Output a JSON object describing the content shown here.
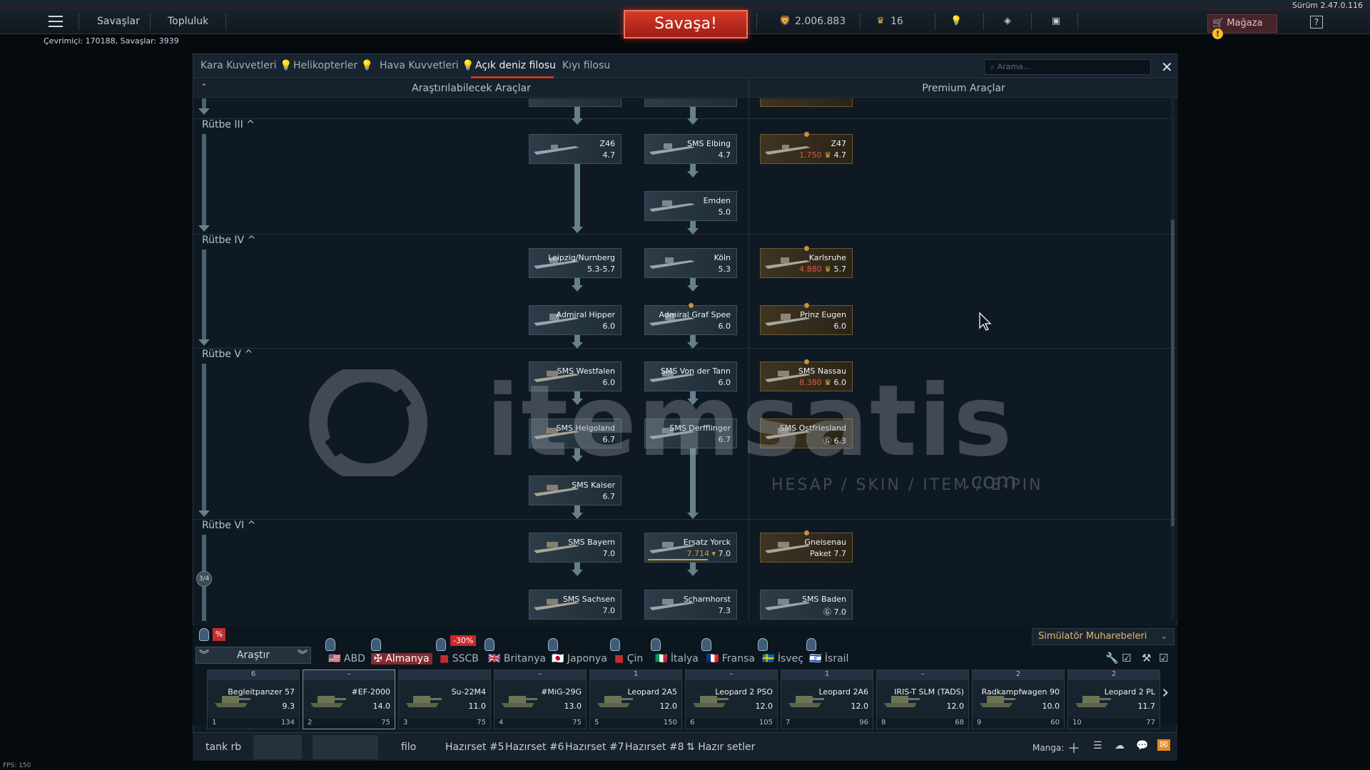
{
  "top": {
    "version": "Sürüm 2.47.0.116",
    "menu_items": [
      "Savaşlar",
      "Topluluk"
    ],
    "battle_button": "Savaşa!",
    "silver": "2.006.883",
    "gold": "16",
    "store": "Mağaza",
    "online": "Çevrimiçi: 170188, Savaşlar: 3939"
  },
  "tabs": {
    "items": [
      "Kara Kuvvetleri",
      "Helikopterler",
      "Hava Kuvvetleri",
      "Açık deniz filosu",
      "Kıyı filosu"
    ],
    "search_placeholder": "Arama..."
  },
  "headers": {
    "researchable": "Araştırılabilecek Araçlar",
    "premium": "Premium Araçlar"
  },
  "ranks": [
    "Rütbe III ^",
    "Rütbe IV ^",
    "Rütbe V ^",
    "Rütbe VI ^"
  ],
  "ships": {
    "z46": {
      "name": "Z46",
      "br": "4.7"
    },
    "elbing": {
      "name": "SMS Elbing",
      "br": "4.7"
    },
    "z47": {
      "name": "Z47",
      "price": "1.750",
      "br": "4.7"
    },
    "emden": {
      "name": "Emden",
      "br": "5.0"
    },
    "leipzig": {
      "name": "Leipzig/Nurnberg",
      "br": "5.3-5.7"
    },
    "koln": {
      "name": "Köln",
      "br": "5.3"
    },
    "karlsruhe": {
      "name": "Karlsruhe",
      "price": "4.880",
      "br": "5.7"
    },
    "hipper": {
      "name": "Admiral Hipper",
      "br": "6.0"
    },
    "spee": {
      "name": "Admiral Graf Spee",
      "br": "6.0"
    },
    "eugen": {
      "name": "Prinz Eugen",
      "br": "6.0"
    },
    "westfalen": {
      "name": "SMS Westfalen",
      "br": "6.0"
    },
    "tann": {
      "name": "SMS Von der Tann",
      "br": "6.0"
    },
    "nassau": {
      "name": "SMS Nassau",
      "price": "8.380",
      "br": "6.0"
    },
    "helgoland": {
      "name": "SMS Helgoland",
      "br": "6.7"
    },
    "derfflinger": {
      "name": "SMS Derfflinger",
      "br": "6.7"
    },
    "ostfriesland": {
      "name": "SMS Ostfriesland",
      "br": "6.3"
    },
    "kaiser": {
      "name": "SMS Kaiser",
      "br": "6.7"
    },
    "bayern": {
      "name": "SMS Bayern",
      "br": "7.0"
    },
    "yorck": {
      "name": "Ersatz Yorck",
      "price": "7.714",
      "br": "7.0"
    },
    "gneisenau": {
      "name": "Gneisenau",
      "sub": "Paket",
      "br": "7.7"
    },
    "sachsen": {
      "name": "SMS Sachsen",
      "br": "7.0"
    },
    "scharnhorst": {
      "name": "Scharnhorst",
      "br": "7.3"
    },
    "baden": {
      "name": "SMS Baden",
      "br": "7.0"
    }
  },
  "progress_badge": "3/4",
  "watermark": {
    "brand": "itemsatis",
    "tagline": "HESAP / SKIN / ITEM / E-PIN",
    "domain": ".com"
  },
  "research": "Araştır",
  "discount": "-30%",
  "mode": "Simülatör Muharebeleri",
  "nations": [
    "ABD",
    "Almanya",
    "SSCB",
    "Britanya",
    "Japonya",
    "Çin",
    "İtalya",
    "Fransa",
    "İsveç",
    "İsrail"
  ],
  "crew": [
    {
      "top": "6",
      "name": "Begleitpanzer 57",
      "br": "9.3",
      "num": "1",
      "cost": "134"
    },
    {
      "top": "–",
      "name": "#EF-2000",
      "br": "14.0",
      "num": "2",
      "cost": "75"
    },
    {
      "top": "",
      "name": "Su-22M4",
      "br": "11.0",
      "num": "3",
      "cost": "75"
    },
    {
      "top": "–",
      "name": "#MiG-29G",
      "br": "13.0",
      "num": "4",
      "cost": "75"
    },
    {
      "top": "1",
      "name": "Leopard 2A5",
      "br": "12.0",
      "num": "5",
      "cost": "150"
    },
    {
      "top": "–",
      "name": "Leopard 2 PSO",
      "br": "12.0",
      "num": "6",
      "cost": "105"
    },
    {
      "top": "1",
      "name": "Leopard 2A6",
      "br": "12.0",
      "num": "7",
      "cost": "96"
    },
    {
      "top": "–",
      "name": "IRIS-T SLM (TADS)",
      "br": "12.0",
      "num": "8",
      "cost": "68"
    },
    {
      "top": "2",
      "name": "Radkampfwagen 90",
      "br": "10.0",
      "num": "9",
      "cost": "60"
    },
    {
      "top": "2",
      "name": "Leopard 2 PL",
      "br": "11.7",
      "num": "10",
      "cost": "77"
    }
  ],
  "bottom_tabs": [
    "tank rb",
    "filo",
    "Hazırset #5",
    "Hazırset #6",
    "Hazırset #7",
    "Hazırset #8",
    "Hazır setler"
  ],
  "manga": "Manga:",
  "fps": "FPS: 150"
}
